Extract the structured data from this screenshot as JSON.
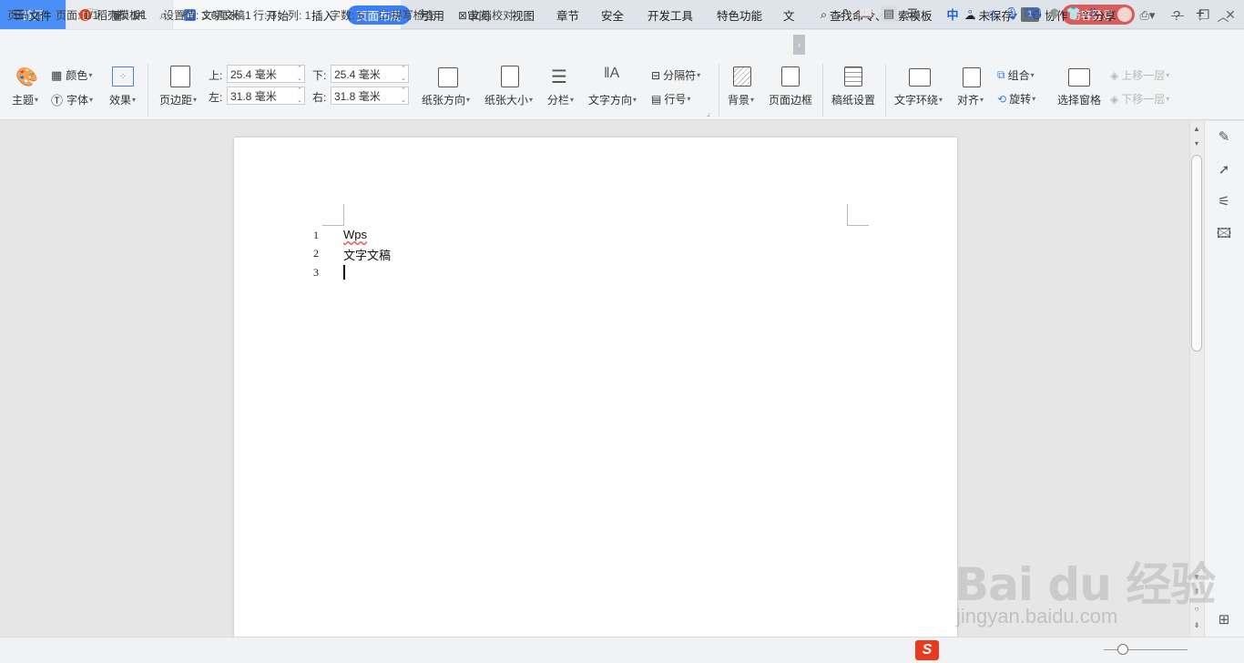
{
  "tabs": {
    "home": "首页",
    "template": "稻壳模板",
    "document": "文字文稿1",
    "add": "+"
  },
  "window": {
    "badge": "1",
    "login": "访客登录",
    "minimize": "—",
    "restore": "❐",
    "close": "✕"
  },
  "menu": {
    "file": "文件",
    "items": [
      "开始",
      "插入",
      "页面布局",
      "引用",
      "审阅",
      "视图",
      "章节",
      "安全",
      "开发工具",
      "特色功能",
      "文"
    ],
    "active": "页面布局",
    "search": "查找命令、搜索模板",
    "unsaved": "未保存",
    "collab": "协作",
    "share": "分享",
    "help": "?"
  },
  "ribbon": {
    "theme": "主题",
    "color": "颜色",
    "font": "字体",
    "effect": "效果",
    "margin": "页边距",
    "margin_top_label": "上:",
    "margin_top": "25.4 毫米",
    "margin_bottom_label": "下:",
    "margin_bottom": "25.4 毫米",
    "margin_left_label": "左:",
    "margin_left": "31.8 毫米",
    "margin_right_label": "右:",
    "margin_right": "31.8 毫米",
    "orientation": "纸张方向",
    "size": "纸张大小",
    "columns": "分栏",
    "text_direction": "文字方向",
    "breaks": "分隔符",
    "line_numbers": "行号",
    "background": "背景",
    "page_border": "页面边框",
    "manuscript": "稿纸设置",
    "wrap": "文字环绕",
    "align": "对齐",
    "group": "组合",
    "rotate": "旋转",
    "selection_pane": "选择窗格",
    "bring_forward": "上移一层",
    "send_backward": "下移一层"
  },
  "document": {
    "lines": [
      {
        "num": "1",
        "text": "Wps"
      },
      {
        "num": "2",
        "text": "文字文稿"
      },
      {
        "num": "3",
        "text": ""
      }
    ]
  },
  "status": {
    "page_code": "页码: 1",
    "pages": "页面: 1/1",
    "section": "节: 1/1",
    "setting": "设置值: 3.6厘米",
    "row": "行: 3",
    "col": "列: 1",
    "words": "字数: 5",
    "spell": "拼写检查",
    "proof": "文档校对",
    "ime_cn": "中",
    "zoom_plus": "+"
  },
  "watermark": {
    "brand": "Bai du 经验",
    "url": "jingyan.baidu.com"
  },
  "colors": {
    "accent": "#3d7ff2",
    "home_tab": "#4a8ff7",
    "login": "#d75c5a",
    "ime": "#e83a1f"
  }
}
